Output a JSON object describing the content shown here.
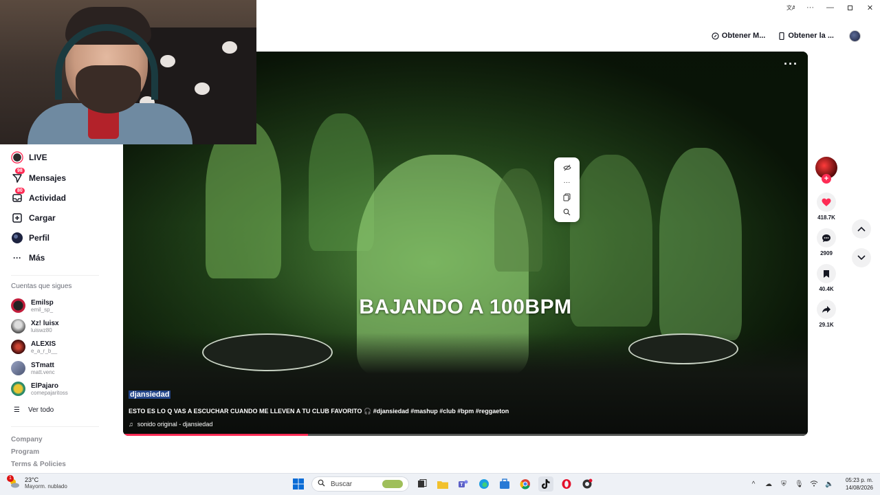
{
  "window": {
    "controls": [
      "translate",
      "more",
      "minimize",
      "maximize",
      "close"
    ]
  },
  "header": {
    "get_coins_label": "Obtener M...",
    "get_app_label": "Obtener la ..."
  },
  "sidebar": {
    "items": [
      {
        "label": "LIVE",
        "icon": "live-avatar-icon"
      },
      {
        "label": "Mensajes",
        "icon": "paper-plane-icon",
        "badge": "98"
      },
      {
        "label": "Actividad",
        "icon": "inbox-icon",
        "badge": "80"
      },
      {
        "label": "Cargar",
        "icon": "plus-square-icon"
      },
      {
        "label": "Perfil",
        "icon": "profile-avatar-icon"
      },
      {
        "label": "Más",
        "icon": "more-icon"
      }
    ],
    "following_title": "Cuentas que sigues",
    "following": [
      {
        "name": "Emilsp",
        "user": "emil_sp_",
        "color": "#c21d3b"
      },
      {
        "name": "Xz! luisx",
        "user": "luiswz80",
        "color": "#555555"
      },
      {
        "name": "ALEXIS",
        "user": "e_a_r_b__",
        "color": "#8a1a1a"
      },
      {
        "name": "STmatt",
        "user": "matt.venc",
        "color": "#7b86a8"
      },
      {
        "name": "ElPajaro",
        "user": "comepajaritoss",
        "color": "#d9b51f"
      }
    ],
    "see_all": "Ver todo",
    "footer": [
      "Company",
      "Program",
      "Terms & Policies"
    ]
  },
  "video": {
    "overlay_text": "BAJANDO A 100BPM",
    "author": "djansiedad",
    "description": "ESTO ES LO Q VAS A ESCUCHAR CUANDO ME LLEVEN A TU CLUB FAVORITO 🎧 #djansiedad #mashup #club #bpm #reggaeton",
    "sound": "sonido original - djansiedad",
    "progress_percent": 27
  },
  "popup": {
    "items": [
      "hide-eye-icon",
      "more-icon",
      "copy-icon",
      "search-icon"
    ]
  },
  "actions": {
    "likes": "418.7K",
    "comments": "2909",
    "saves": "40.4K",
    "shares": "29.1K"
  },
  "taskbar": {
    "temperature": "23°C",
    "weather": "Mayorm. nublado",
    "weather_alert": "1",
    "search_placeholder": "Buscar",
    "time": "05:23 p. m.",
    "date": "14/08/2026"
  },
  "colors": {
    "accent": "#fe2c55",
    "text": "#161823"
  }
}
